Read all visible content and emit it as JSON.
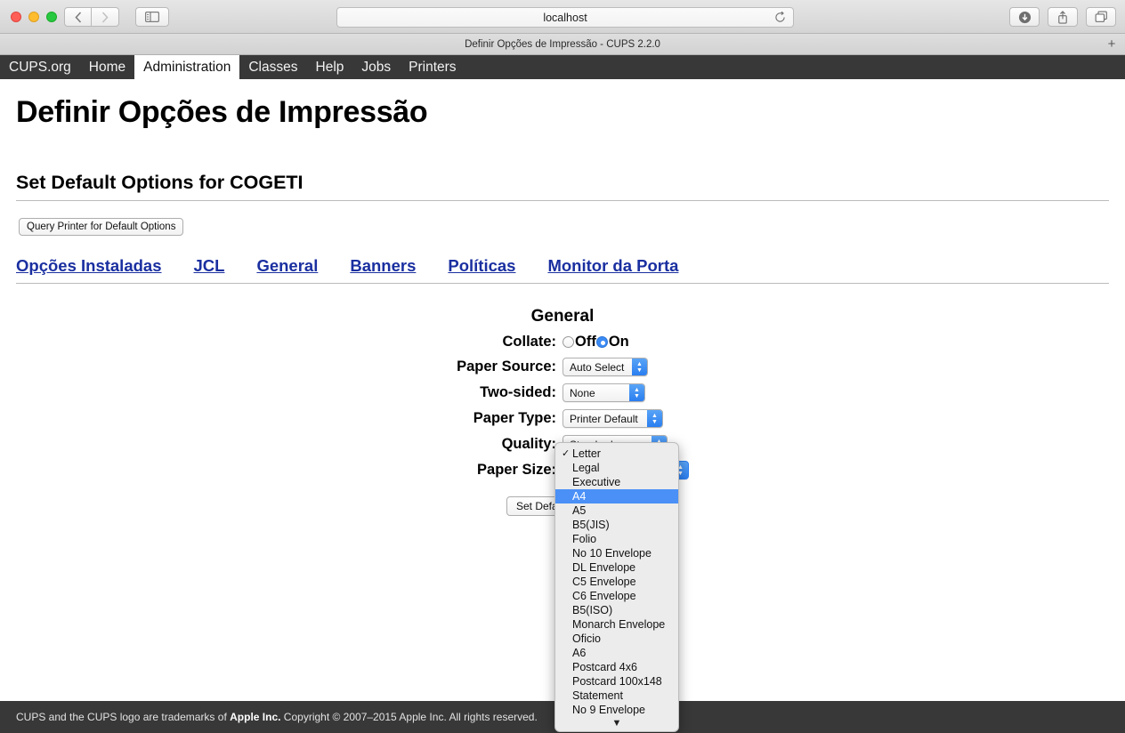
{
  "browser": {
    "url": "localhost",
    "reload_icon": "reload-icon",
    "back_icon": "chevron-left-icon",
    "forward_icon": "chevron-right-icon",
    "sidebar_icon": "sidebar-toggle-icon",
    "download_icon": "download-icon",
    "share_icon": "share-icon",
    "tabs_icon": "show-tabs-icon",
    "new_tab_label": "+",
    "tab_title": "Definir Opções de Impressão - CUPS 2.2.0"
  },
  "cups_nav": {
    "items": [
      {
        "label": "CUPS.org",
        "active": false
      },
      {
        "label": "Home",
        "active": false
      },
      {
        "label": "Administration",
        "active": true
      },
      {
        "label": "Classes",
        "active": false
      },
      {
        "label": "Help",
        "active": false
      },
      {
        "label": "Jobs",
        "active": false
      },
      {
        "label": "Printers",
        "active": false
      }
    ]
  },
  "page": {
    "title": "Definir Opções de Impressão",
    "section_title": "Set Default Options for COGETI",
    "query_button": "Query Printer for Default Options",
    "option_tabs": [
      "Opções Instaladas",
      "JCL",
      "General",
      "Banners",
      "Políticas",
      "Monitor da Porta"
    ]
  },
  "form": {
    "heading": "General",
    "collate": {
      "label": "Collate:",
      "off_label": "Off",
      "on_label": "On",
      "selected": "On"
    },
    "paper_source": {
      "label": "Paper Source:",
      "value": "Auto Select"
    },
    "two_sided": {
      "label": "Two-sided:",
      "value": "None"
    },
    "paper_type": {
      "label": "Paper Type:",
      "value": "Printer Default"
    },
    "quality": {
      "label": "Quality:",
      "value": "Standard"
    },
    "paper_size": {
      "label": "Paper Size:",
      "value": "Letter"
    },
    "submit_label": "Set Default Options"
  },
  "paper_size_menu": {
    "checked": "Letter",
    "highlighted": "A4",
    "scroll_arrow": "▼",
    "items": [
      "Letter",
      "Legal",
      "Executive",
      "A4",
      "A5",
      "B5(JIS)",
      "Folio",
      "No 10 Envelope",
      "DL Envelope",
      "C5 Envelope",
      "C6 Envelope",
      "B5(ISO)",
      "Monarch Envelope",
      "Oficio",
      "A6",
      "Postcard 4x6",
      "Postcard 100x148",
      "Statement",
      "No 9 Envelope"
    ]
  },
  "footer": {
    "text_before": "CUPS and the CUPS logo are trademarks of ",
    "bold": "Apple Inc.",
    "text_after": " Copyright © 2007–2015 Apple Inc. All rights reserved."
  },
  "colors": {
    "nav_bg": "#383838",
    "link_blue": "#1a2fa0",
    "accent_blue": "#4a90f7",
    "select_arrow_blue": "#2a7ef0"
  }
}
